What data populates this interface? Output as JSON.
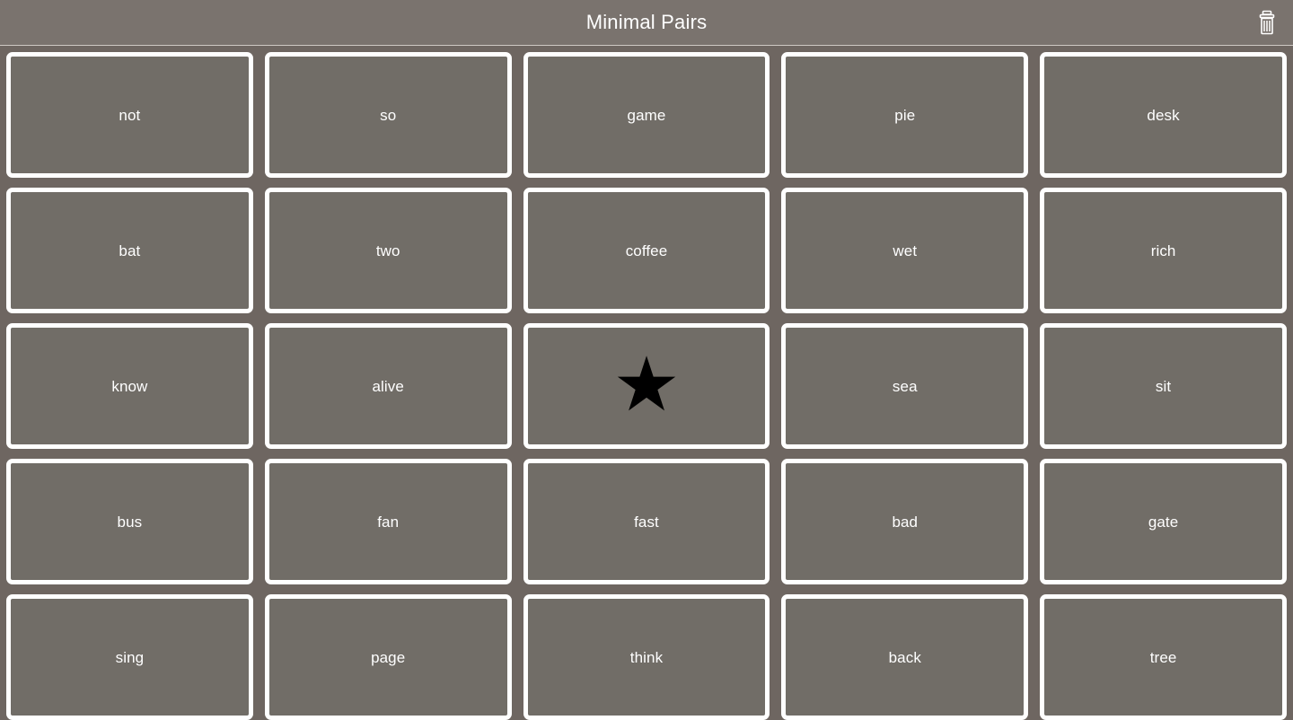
{
  "header": {
    "title": "Minimal Pairs",
    "trash_icon": "trash-icon",
    "background_color": "#7a736e",
    "title_color": "#ffffff"
  },
  "theme": {
    "page_background": "#6e6661",
    "card_background": "#716d67",
    "card_border": "#ffffff",
    "text_color": "#ffffff",
    "star_color": "#000000"
  },
  "board": {
    "columns": 5,
    "rows": 5,
    "cards": [
      {
        "label": "not",
        "type": "word"
      },
      {
        "label": "so",
        "type": "word"
      },
      {
        "label": "game",
        "type": "word"
      },
      {
        "label": "pie",
        "type": "word"
      },
      {
        "label": "desk",
        "type": "word"
      },
      {
        "label": "bat",
        "type": "word"
      },
      {
        "label": "two",
        "type": "word"
      },
      {
        "label": "coffee",
        "type": "word"
      },
      {
        "label": "wet",
        "type": "word"
      },
      {
        "label": "rich",
        "type": "word"
      },
      {
        "label": "know",
        "type": "word"
      },
      {
        "label": "alive",
        "type": "word"
      },
      {
        "label": "★",
        "type": "star"
      },
      {
        "label": "sea",
        "type": "word"
      },
      {
        "label": "sit",
        "type": "word"
      },
      {
        "label": "bus",
        "type": "word"
      },
      {
        "label": "fan",
        "type": "word"
      },
      {
        "label": "fast",
        "type": "word"
      },
      {
        "label": "bad",
        "type": "word"
      },
      {
        "label": "gate",
        "type": "word"
      },
      {
        "label": "sing",
        "type": "word"
      },
      {
        "label": "page",
        "type": "word"
      },
      {
        "label": "think",
        "type": "word"
      },
      {
        "label": "back",
        "type": "word"
      },
      {
        "label": "tree",
        "type": "word"
      }
    ]
  }
}
